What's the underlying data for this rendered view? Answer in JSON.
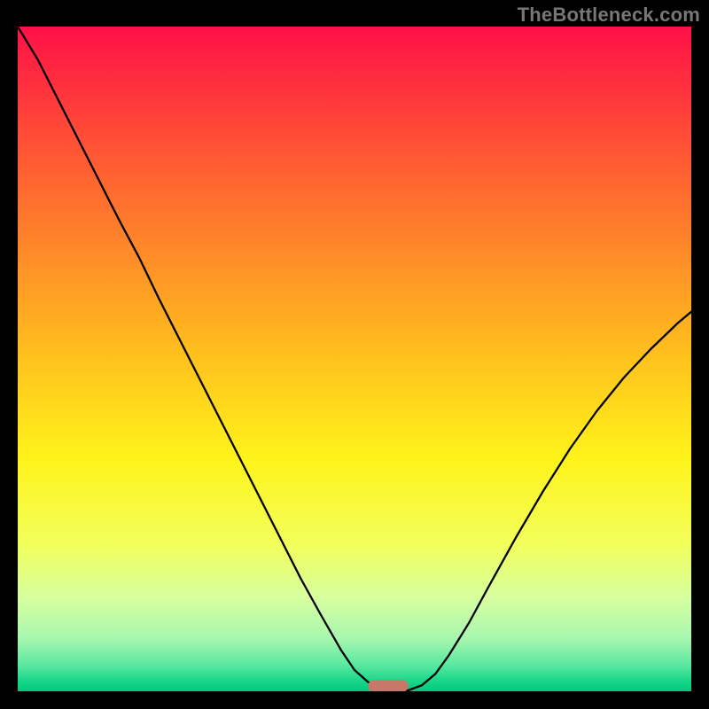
{
  "watermark": "TheBottleneck.com",
  "chart_data": {
    "type": "line",
    "title": "",
    "xlabel": "",
    "ylabel": "",
    "xlim": [
      0,
      100
    ],
    "ylim": [
      0,
      100
    ],
    "grid": false,
    "axes_visible": false,
    "background": {
      "gradient_stops": [
        {
          "offset": 0.0,
          "color": "#ff1049"
        },
        {
          "offset": 0.08,
          "color": "#ff2d3f"
        },
        {
          "offset": 0.2,
          "color": "#ff5a33"
        },
        {
          "offset": 0.35,
          "color": "#ff8e28"
        },
        {
          "offset": 0.5,
          "color": "#ffc21e"
        },
        {
          "offset": 0.65,
          "color": "#fff31a"
        },
        {
          "offset": 0.78,
          "color": "#f2ff5c"
        },
        {
          "offset": 0.86,
          "color": "#d7ffa0"
        },
        {
          "offset": 0.92,
          "color": "#a8f7b0"
        },
        {
          "offset": 0.96,
          "color": "#5be8a0"
        },
        {
          "offset": 0.985,
          "color": "#18d68a"
        },
        {
          "offset": 1.0,
          "color": "#00c87c"
        }
      ]
    },
    "series": [
      {
        "name": "bottleneck-curve",
        "color": "#000000",
        "stroke_width": 2.3,
        "x": [
          0,
          3,
          6,
          9,
          12,
          15,
          18,
          21,
          24,
          27,
          30,
          33,
          36,
          39,
          42,
          45,
          48,
          50,
          52,
          54,
          56,
          58,
          60,
          62,
          64,
          67,
          70,
          74,
          78,
          82,
          86,
          90,
          94,
          98,
          100
        ],
        "y": [
          100,
          95,
          89,
          83,
          77,
          71,
          65.3,
          59,
          53,
          47,
          41,
          35,
          29,
          23,
          17,
          11.5,
          6.2,
          3.2,
          1.4,
          0.3,
          0.05,
          0.15,
          0.9,
          2.6,
          5.4,
          10.3,
          15.9,
          23.2,
          30.1,
          36.5,
          42.2,
          47.2,
          51.5,
          55.4,
          57.1
        ]
      }
    ],
    "trough_marker": {
      "name": "min-marker",
      "color": "#c87868",
      "x_start": 52,
      "x_end": 58,
      "y": 0.8,
      "cap_height": 1.8,
      "cap_width": 2.0
    }
  }
}
